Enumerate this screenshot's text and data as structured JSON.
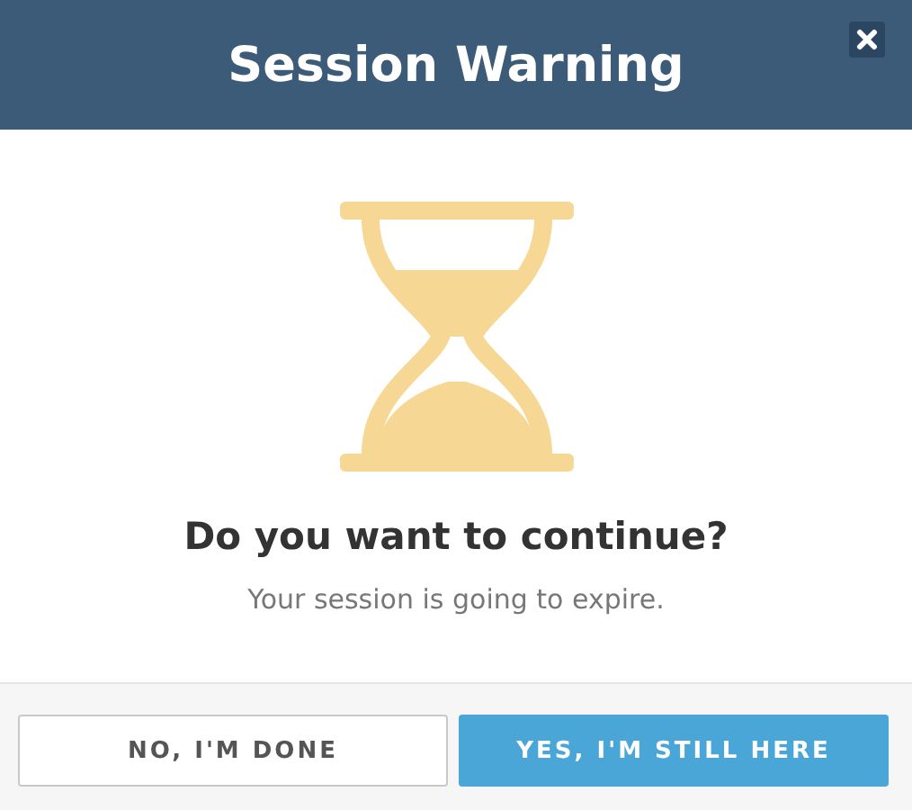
{
  "dialog": {
    "title": "Session Warning",
    "heading": "Do you want to continue?",
    "message": "Your session is going to expire.",
    "buttons": [
      {
        "label": "NO, I'M DONE",
        "kind": "secondary"
      },
      {
        "label": "YES, I'M STILL HERE",
        "kind": "primary"
      }
    ]
  }
}
